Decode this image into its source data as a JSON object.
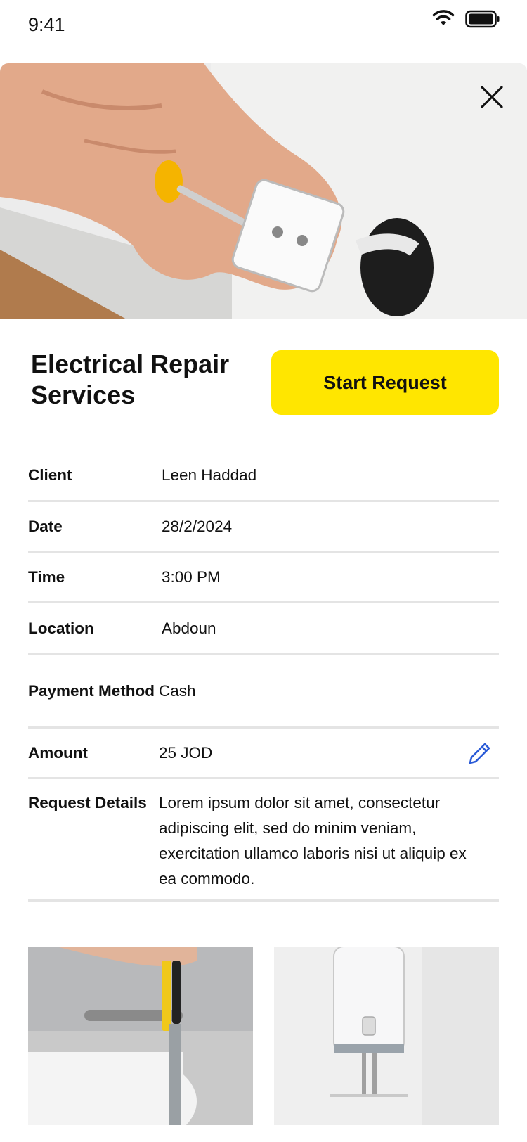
{
  "status_bar": {
    "time": "9:41",
    "icons": [
      "wifi-icon",
      "battery-icon"
    ]
  },
  "hero": {
    "image": "electrician-installing-wall-socket",
    "close_icon": "close-icon"
  },
  "service": {
    "title": "Electrical Repair Services",
    "start_button": "Start Request"
  },
  "details": {
    "rows": [
      {
        "label": "Client",
        "value": "Leen Haddad"
      },
      {
        "label": "Date",
        "value": "28/2/2024"
      },
      {
        "label": "Time",
        "value": "3:00 PM"
      },
      {
        "label": "Location",
        "value": "Abdoun"
      },
      {
        "label": "Payment Method",
        "value": "Cash"
      },
      {
        "label": "Amount",
        "value": "25 JOD",
        "edit_icon": "pencil-icon"
      },
      {
        "label": "Request Details",
        "value": "Lorem ipsum dolor sit amet, consectetur adipiscing elit, sed do minim veniam, exercitation ullamco laboris nisi ut aliquip ex ea commodo."
      }
    ]
  },
  "gallery": {
    "images": [
      "water-heater-pipe-repair",
      "wall-mounted-water-heater"
    ]
  },
  "colors": {
    "accent": "#ffe600",
    "edit_icon": "#2a5bd7",
    "divider": "#e4e4e4"
  }
}
